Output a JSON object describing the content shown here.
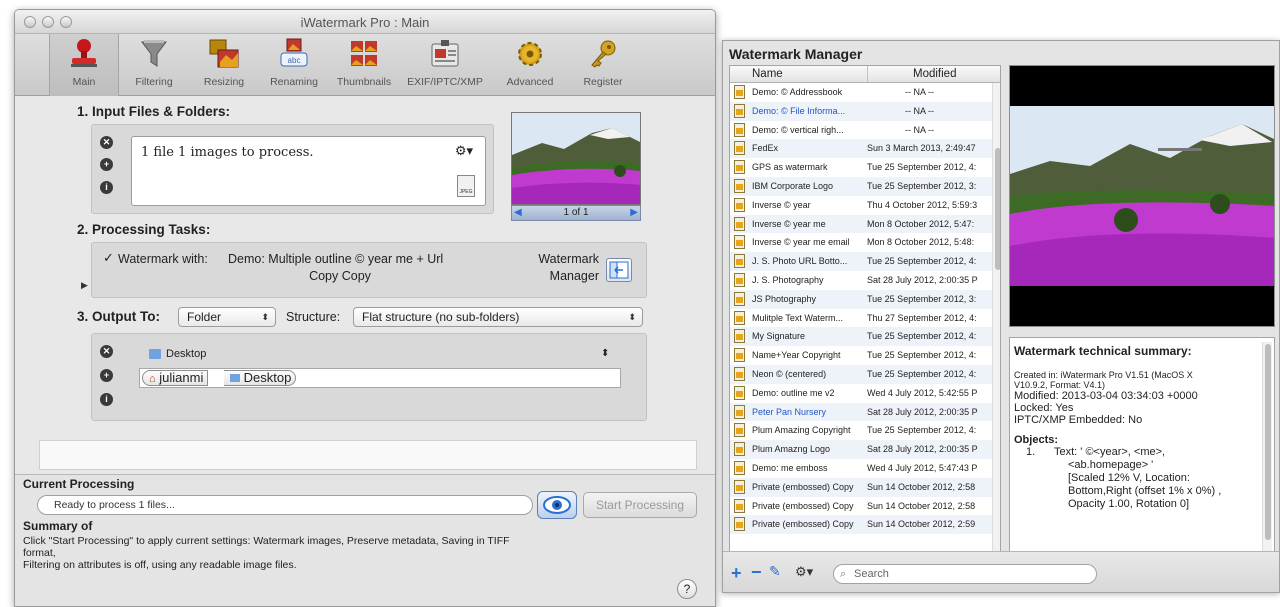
{
  "main": {
    "title": "iWatermark Pro : Main",
    "toolbar": [
      {
        "label": "Main",
        "icon": "stamp-icon"
      },
      {
        "label": "Filtering",
        "icon": "funnel-icon"
      },
      {
        "label": "Resizing",
        "icon": "resize-icon"
      },
      {
        "label": "Renaming",
        "icon": "rename-icon"
      },
      {
        "label": "Thumbnails",
        "icon": "thumbnails-icon"
      },
      {
        "label": "EXIF/IPTC/XMP",
        "icon": "exif-icon"
      },
      {
        "label": "Advanced",
        "icon": "gear-icon"
      },
      {
        "label": "Register",
        "icon": "key-icon"
      }
    ],
    "input": {
      "title": "1. Input Files & Folders:",
      "status": "1 file 1 images to process.",
      "file_type": "JPEG",
      "nav_label": "1 of 1"
    },
    "tasks": {
      "title": "2. Processing Tasks:",
      "watermark_label": "Watermark with:",
      "watermark_value_line1": "Demo: Multiple outline © year me + Url",
      "watermark_value_line2": "Copy Copy",
      "manager_line1": "Watermark",
      "manager_line2": "Manager"
    },
    "output": {
      "title": "3. Output To:",
      "output_type": "Folder",
      "structure_label": "Structure:",
      "structure_value": "Flat structure (no sub-folders)",
      "folder_name": "Desktop",
      "path_home": "julianmi",
      "path_folder": "Desktop"
    },
    "processing": {
      "current_title": "Current Processing",
      "status_text": "Ready to process 1 files...",
      "start_button": "Start Processing",
      "summary_title": "Summary of",
      "summary_line1": "Click \"Start Processing\" to apply current settings: Watermark images, Preserve metadata, Saving in TIFF",
      "summary_line2": "format,",
      "summary_line3": "Filtering on attributes is off, using any readable image files.",
      "help_label": "?"
    }
  },
  "manager": {
    "title": "Watermark Manager",
    "col_name": "Name",
    "col_modified": "Modified",
    "rows": [
      {
        "name": "Demo: © Addressbook",
        "modified": "-- NA --"
      },
      {
        "name": "Demo: © File Informa...",
        "modified": "-- NA --"
      },
      {
        "name": "Demo: © vertical righ...",
        "modified": "-- NA --"
      },
      {
        "name": "FedEx",
        "modified": "Sun 3 March 2013, 2:49:47"
      },
      {
        "name": "GPS as watermark",
        "modified": "Tue 25 September 2012, 4:"
      },
      {
        "name": "IBM Corporate Logo",
        "modified": "Tue 25 September 2012, 3:"
      },
      {
        "name": "Inverse © year",
        "modified": "Thu 4 October 2012, 5:59:3"
      },
      {
        "name": "Inverse © year me",
        "modified": "Mon 8 October 2012, 5:47:"
      },
      {
        "name": "Inverse © year me email",
        "modified": "Mon 8 October 2012, 5:48:"
      },
      {
        "name": "J. S. Photo URL Botto...",
        "modified": "Tue 25 September 2012, 4:"
      },
      {
        "name": "J. S. Photography",
        "modified": "Sat 28 July 2012, 2:00:35 P"
      },
      {
        "name": "JS Photography",
        "modified": "Tue 25 September 2012, 3:"
      },
      {
        "name": "Mulitple Text Waterm...",
        "modified": "Thu 27 September 2012, 4:"
      },
      {
        "name": "My Signature",
        "modified": "Tue 25 September 2012, 4:"
      },
      {
        "name": "Name+Year Copyright",
        "modified": "Tue 25 September 2012, 4:"
      },
      {
        "name": "Neon © (centered)",
        "modified": "Tue 25 September 2012, 4:"
      },
      {
        "name": "Demo: outline me v2",
        "modified": "Wed 4 July 2012, 5:42:55 P"
      },
      {
        "name": "Peter Pan Nursery",
        "modified": "Sat 28 July 2012, 2:00:35 P"
      },
      {
        "name": "Plum Amazing Copyright",
        "modified": "Tue 25 September 2012, 4:"
      },
      {
        "name": "Plum Amazng Logo",
        "modified": "Sat 28 July 2012, 2:00:35 P"
      },
      {
        "name": "Demo: me emboss",
        "modified": "Wed 4 July 2012, 5:47:43 P"
      },
      {
        "name": "Private (embossed) Copy",
        "modified": "Sun 14 October 2012, 2:58"
      },
      {
        "name": "Private (embossed) Copy",
        "modified": "Sun 14 October 2012, 2:58"
      },
      {
        "name": "Private (embossed) Copy",
        "modified": "Sun 14 October 2012, 2:59"
      }
    ],
    "summary": {
      "title": "Watermark technical summary:",
      "created_line1": "Created in: iWatermark Pro V1.51 (MacOS X",
      "created_line2": "V10.9.2, Format: V4.1)",
      "modified": "Modified: 2013-03-04 03:34:03 +0000",
      "locked": "Locked: Yes",
      "iptc": "IPTC/XMP Embedded: No",
      "objects_title": "Objects:",
      "obj_num": "1.",
      "obj_line1": "Text: ' ©<year>, <me>,",
      "obj_line2": "<ab.homepage> '",
      "obj_line3": "[Scaled 12% V, Location:",
      "obj_line4": "Bottom,Right (offset 1% x 0%) ,",
      "obj_line5": "Opacity 1.00, Rotation 0]"
    },
    "search_placeholder": "Search"
  },
  "colors": {
    "selection_blue": "#1f55c8",
    "accent_blue": "#2a6fd3",
    "flower_magenta": "#c13ad0"
  }
}
